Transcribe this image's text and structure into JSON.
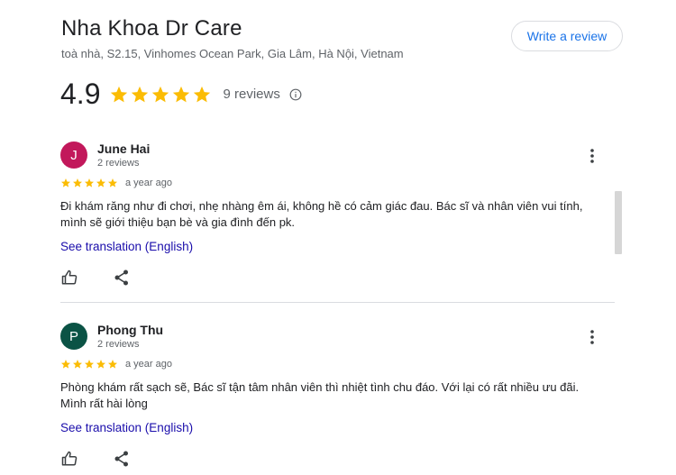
{
  "place": {
    "name": "Nha Khoa Dr Care",
    "address": "toà nhà, S2.15, Vinhomes Ocean Park, Gia Lâm, Hà Nội, Vietnam"
  },
  "write_review_label": "Write a review",
  "rating": {
    "value": "4.9",
    "stars": 5,
    "count_label": "9 reviews"
  },
  "colors": {
    "star": "#fbbc04",
    "link": "#1a0dab",
    "button_text": "#1a73e8"
  },
  "reviews": [
    {
      "initial": "J",
      "avatar_color": "#c2185b",
      "author": "June Hai",
      "author_reviews": "2 reviews",
      "stars": 5,
      "date": "a year ago",
      "text": "Đi khám răng như đi chơi, nhẹ nhàng êm ái, không hề có cảm giác đau. Bác sĩ và nhân viên vui tính, mình sẽ giới thiệu bạn bè và gia đình đến pk.",
      "translate_label": "See translation (English)"
    },
    {
      "initial": "P",
      "avatar_color": "#0b5345",
      "author": "Phong Thu",
      "author_reviews": "2 reviews",
      "stars": 5,
      "date": "a year ago",
      "text": "Phòng khám rất sạch sẽ, Bác sĩ tận tâm nhân viên thì nhiệt tình chu đáo. Với lại có rất nhiều ưu đãi. Mình rất hài lòng",
      "translate_label": "See translation (English)"
    }
  ],
  "icons": {
    "info": "info-icon",
    "more": "more-vert-icon",
    "like": "thumb-up-icon",
    "share": "share-icon",
    "star": "star-icon"
  }
}
